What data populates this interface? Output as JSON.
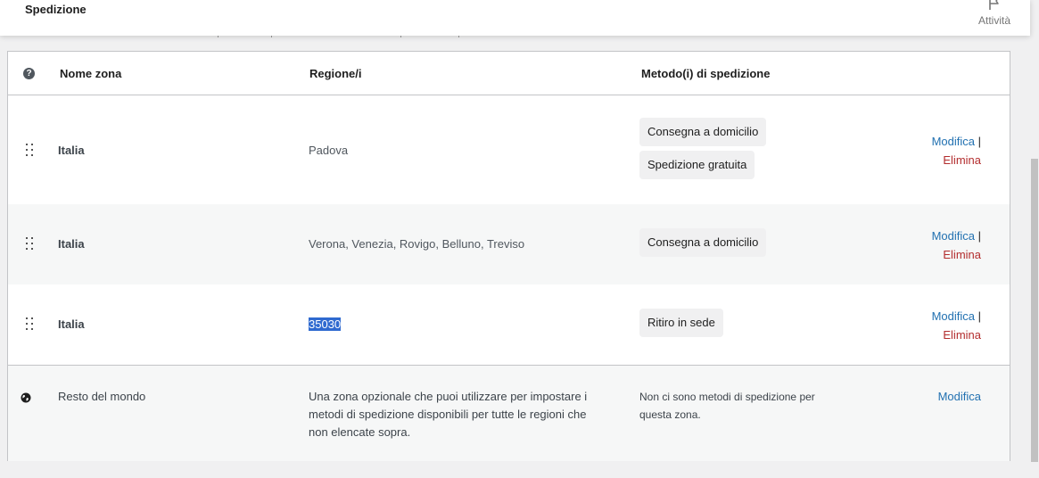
{
  "header": {
    "title": "Spedizione",
    "activity_label": "Attività"
  },
  "table": {
    "columns": {
      "help_glyph": "?",
      "zone_name": "Nome zona",
      "regions": "Regione/i",
      "methods": "Metodo(i) di spedizione"
    },
    "rows": [
      {
        "zone": "Italia",
        "regions": "Padova",
        "methods": [
          "Consegna a domicilio",
          "Spedizione gratuita"
        ],
        "edit_label": "Modifica",
        "separator": "|",
        "delete_label": "Elimina"
      },
      {
        "zone": "Italia",
        "regions": "Verona, Venezia, Rovigo, Belluno, Treviso",
        "methods": [
          "Consegna a domicilio"
        ],
        "edit_label": "Modifica",
        "separator": "|",
        "delete_label": "Elimina"
      },
      {
        "zone": "Italia",
        "regions": "35030",
        "methods": [
          "Ritiro in sede"
        ],
        "edit_label": "Modifica",
        "separator": "|",
        "delete_label": "Elimina"
      }
    ],
    "rest_of_world": {
      "zone": "Resto del mondo",
      "description_lines": [
        "Una zona opzionale che puoi utilizzare per impostare i",
        "metodi di spedizione disponibili per tutte le regioni che",
        "non elencate sopra."
      ],
      "no_methods_lines": [
        "Non ci sono metodi di spedizione per",
        "questa zona."
      ],
      "edit_label": "Modifica"
    }
  },
  "colors": {
    "link": "#2271b1",
    "delete": "#b32d2e",
    "selection": "#2f6ad0"
  }
}
